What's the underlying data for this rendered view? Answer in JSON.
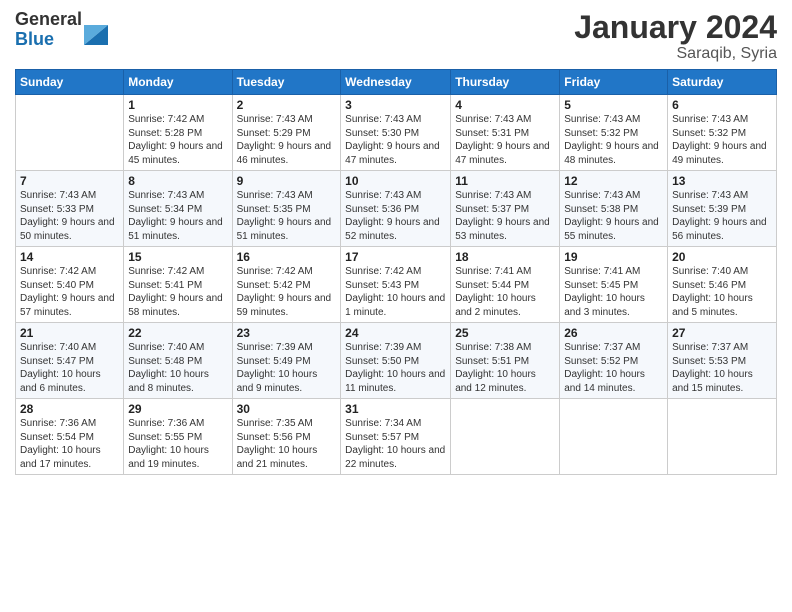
{
  "logo": {
    "general": "General",
    "blue": "Blue"
  },
  "title": "January 2024",
  "location": "Saraqib, Syria",
  "weekdays": [
    "Sunday",
    "Monday",
    "Tuesday",
    "Wednesday",
    "Thursday",
    "Friday",
    "Saturday"
  ],
  "weeks": [
    [
      {
        "day": "",
        "sunrise": "",
        "sunset": "",
        "daylight": ""
      },
      {
        "day": "1",
        "sunrise": "Sunrise: 7:42 AM",
        "sunset": "Sunset: 5:28 PM",
        "daylight": "Daylight: 9 hours and 45 minutes."
      },
      {
        "day": "2",
        "sunrise": "Sunrise: 7:43 AM",
        "sunset": "Sunset: 5:29 PM",
        "daylight": "Daylight: 9 hours and 46 minutes."
      },
      {
        "day": "3",
        "sunrise": "Sunrise: 7:43 AM",
        "sunset": "Sunset: 5:30 PM",
        "daylight": "Daylight: 9 hours and 47 minutes."
      },
      {
        "day": "4",
        "sunrise": "Sunrise: 7:43 AM",
        "sunset": "Sunset: 5:31 PM",
        "daylight": "Daylight: 9 hours and 47 minutes."
      },
      {
        "day": "5",
        "sunrise": "Sunrise: 7:43 AM",
        "sunset": "Sunset: 5:32 PM",
        "daylight": "Daylight: 9 hours and 48 minutes."
      },
      {
        "day": "6",
        "sunrise": "Sunrise: 7:43 AM",
        "sunset": "Sunset: 5:32 PM",
        "daylight": "Daylight: 9 hours and 49 minutes."
      }
    ],
    [
      {
        "day": "7",
        "sunrise": "Sunrise: 7:43 AM",
        "sunset": "Sunset: 5:33 PM",
        "daylight": "Daylight: 9 hours and 50 minutes."
      },
      {
        "day": "8",
        "sunrise": "Sunrise: 7:43 AM",
        "sunset": "Sunset: 5:34 PM",
        "daylight": "Daylight: 9 hours and 51 minutes."
      },
      {
        "day": "9",
        "sunrise": "Sunrise: 7:43 AM",
        "sunset": "Sunset: 5:35 PM",
        "daylight": "Daylight: 9 hours and 51 minutes."
      },
      {
        "day": "10",
        "sunrise": "Sunrise: 7:43 AM",
        "sunset": "Sunset: 5:36 PM",
        "daylight": "Daylight: 9 hours and 52 minutes."
      },
      {
        "day": "11",
        "sunrise": "Sunrise: 7:43 AM",
        "sunset": "Sunset: 5:37 PM",
        "daylight": "Daylight: 9 hours and 53 minutes."
      },
      {
        "day": "12",
        "sunrise": "Sunrise: 7:43 AM",
        "sunset": "Sunset: 5:38 PM",
        "daylight": "Daylight: 9 hours and 55 minutes."
      },
      {
        "day": "13",
        "sunrise": "Sunrise: 7:43 AM",
        "sunset": "Sunset: 5:39 PM",
        "daylight": "Daylight: 9 hours and 56 minutes."
      }
    ],
    [
      {
        "day": "14",
        "sunrise": "Sunrise: 7:42 AM",
        "sunset": "Sunset: 5:40 PM",
        "daylight": "Daylight: 9 hours and 57 minutes."
      },
      {
        "day": "15",
        "sunrise": "Sunrise: 7:42 AM",
        "sunset": "Sunset: 5:41 PM",
        "daylight": "Daylight: 9 hours and 58 minutes."
      },
      {
        "day": "16",
        "sunrise": "Sunrise: 7:42 AM",
        "sunset": "Sunset: 5:42 PM",
        "daylight": "Daylight: 9 hours and 59 minutes."
      },
      {
        "day": "17",
        "sunrise": "Sunrise: 7:42 AM",
        "sunset": "Sunset: 5:43 PM",
        "daylight": "Daylight: 10 hours and 1 minute."
      },
      {
        "day": "18",
        "sunrise": "Sunrise: 7:41 AM",
        "sunset": "Sunset: 5:44 PM",
        "daylight": "Daylight: 10 hours and 2 minutes."
      },
      {
        "day": "19",
        "sunrise": "Sunrise: 7:41 AM",
        "sunset": "Sunset: 5:45 PM",
        "daylight": "Daylight: 10 hours and 3 minutes."
      },
      {
        "day": "20",
        "sunrise": "Sunrise: 7:40 AM",
        "sunset": "Sunset: 5:46 PM",
        "daylight": "Daylight: 10 hours and 5 minutes."
      }
    ],
    [
      {
        "day": "21",
        "sunrise": "Sunrise: 7:40 AM",
        "sunset": "Sunset: 5:47 PM",
        "daylight": "Daylight: 10 hours and 6 minutes."
      },
      {
        "day": "22",
        "sunrise": "Sunrise: 7:40 AM",
        "sunset": "Sunset: 5:48 PM",
        "daylight": "Daylight: 10 hours and 8 minutes."
      },
      {
        "day": "23",
        "sunrise": "Sunrise: 7:39 AM",
        "sunset": "Sunset: 5:49 PM",
        "daylight": "Daylight: 10 hours and 9 minutes."
      },
      {
        "day": "24",
        "sunrise": "Sunrise: 7:39 AM",
        "sunset": "Sunset: 5:50 PM",
        "daylight": "Daylight: 10 hours and 11 minutes."
      },
      {
        "day": "25",
        "sunrise": "Sunrise: 7:38 AM",
        "sunset": "Sunset: 5:51 PM",
        "daylight": "Daylight: 10 hours and 12 minutes."
      },
      {
        "day": "26",
        "sunrise": "Sunrise: 7:37 AM",
        "sunset": "Sunset: 5:52 PM",
        "daylight": "Daylight: 10 hours and 14 minutes."
      },
      {
        "day": "27",
        "sunrise": "Sunrise: 7:37 AM",
        "sunset": "Sunset: 5:53 PM",
        "daylight": "Daylight: 10 hours and 15 minutes."
      }
    ],
    [
      {
        "day": "28",
        "sunrise": "Sunrise: 7:36 AM",
        "sunset": "Sunset: 5:54 PM",
        "daylight": "Daylight: 10 hours and 17 minutes."
      },
      {
        "day": "29",
        "sunrise": "Sunrise: 7:36 AM",
        "sunset": "Sunset: 5:55 PM",
        "daylight": "Daylight: 10 hours and 19 minutes."
      },
      {
        "day": "30",
        "sunrise": "Sunrise: 7:35 AM",
        "sunset": "Sunset: 5:56 PM",
        "daylight": "Daylight: 10 hours and 21 minutes."
      },
      {
        "day": "31",
        "sunrise": "Sunrise: 7:34 AM",
        "sunset": "Sunset: 5:57 PM",
        "daylight": "Daylight: 10 hours and 22 minutes."
      },
      {
        "day": "",
        "sunrise": "",
        "sunset": "",
        "daylight": ""
      },
      {
        "day": "",
        "sunrise": "",
        "sunset": "",
        "daylight": ""
      },
      {
        "day": "",
        "sunrise": "",
        "sunset": "",
        "daylight": ""
      }
    ]
  ]
}
